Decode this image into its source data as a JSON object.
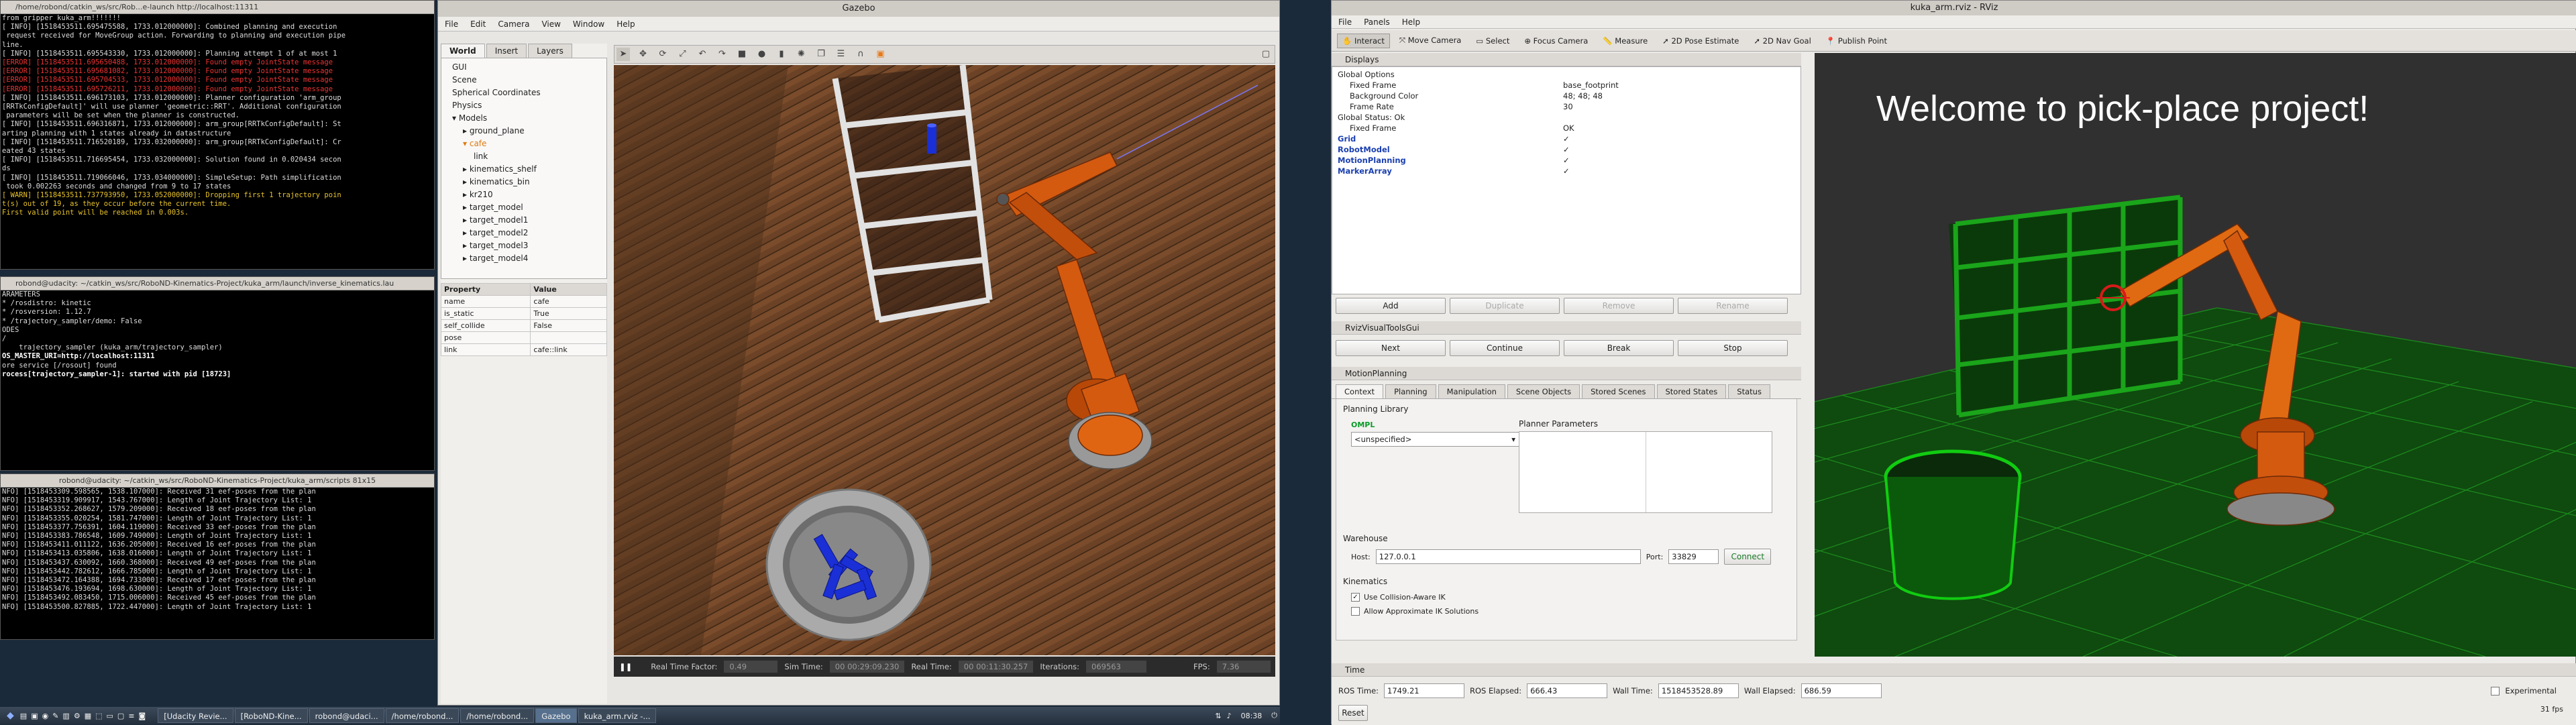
{
  "term1": {
    "title": "/home/robond/catkin_ws/src/Rob...e-launch http://localhost:11311",
    "lines": [
      {
        "t": "from gripper kuka_arm!!!!!!!",
        "c": "c-w"
      },
      {
        "t": "[ INFO] [1518453511.695475588, 1733.012000000]: Combined planning and execution",
        "c": "c-w"
      },
      {
        "t": " request received for MoveGroup action. Forwarding to planning and execution pipe",
        "c": "c-w"
      },
      {
        "t": "line.",
        "c": "c-w"
      },
      {
        "t": "[ INFO] [1518453511.695543330, 1733.012000000]: Planning attempt 1 of at most 1",
        "c": "c-w"
      },
      {
        "t": "[ERROR] [1518453511.695650488, 1733.012000000]: Found empty JointState message",
        "c": "c-r"
      },
      {
        "t": "[ERROR] [1518453511.695681082, 1733.012000000]: Found empty JointState message",
        "c": "c-r"
      },
      {
        "t": "[ERROR] [1518453511.695704533, 1733.012000000]: Found empty JointState message",
        "c": "c-r"
      },
      {
        "t": "[ERROR] [1518453511.695726211, 1733.012000000]: Found empty JointState message",
        "c": "c-r"
      },
      {
        "t": "[ INFO] [1518453511.696173103, 1733.012000000]: Planner configuration 'arm_group",
        "c": "c-w"
      },
      {
        "t": "[RRTkConfigDefault]' will use planner 'geometric::RRT'. Additional configuration",
        "c": "c-w"
      },
      {
        "t": " parameters will be set when the planner is constructed.",
        "c": "c-w"
      },
      {
        "t": "[ INFO] [1518453511.696316871, 1733.012000000]: arm_group[RRTkConfigDefault]: St",
        "c": "c-w"
      },
      {
        "t": "arting planning with 1 states already in datastructure",
        "c": "c-w"
      },
      {
        "t": "[ INFO] [1518453511.716520189, 1733.032000000]: arm_group[RRTkConfigDefault]: Cr",
        "c": "c-w"
      },
      {
        "t": "eated 43 states",
        "c": "c-w"
      },
      {
        "t": "[ INFO] [1518453511.716695454, 1733.032000000]: Solution found in 0.020434 secon",
        "c": "c-w"
      },
      {
        "t": "ds",
        "c": "c-w"
      },
      {
        "t": "[ INFO] [1518453511.719066046, 1733.034000000]: SimpleSetup: Path simplification",
        "c": "c-w"
      },
      {
        "t": " took 0.002263 seconds and changed from 9 to 17 states",
        "c": "c-w"
      },
      {
        "t": "[ WARN] [1518453511.737793950, 1733.052000000]: Dropping first 1 trajectory poin",
        "c": "c-y"
      },
      {
        "t": "t(s) out of 19, as they occur before the current time.",
        "c": "c-y"
      },
      {
        "t": "First valid point will be reached in 0.003s.",
        "c": "c-y"
      }
    ]
  },
  "term2": {
    "title": "robond@udacity: ~/catkin_ws/src/RoboND-Kinematics-Project/kuka_arm/launch/inverse_kinematics.lau",
    "lines": [
      {
        "t": "",
        "c": "c-w"
      },
      {
        "t": "",
        "c": "c-w"
      },
      {
        "t": "ARAMETERS",
        "c": "c-w"
      },
      {
        "t": "* /rosdistro: kinetic",
        "c": "c-w"
      },
      {
        "t": "* /rosversion: 1.12.7",
        "c": "c-w"
      },
      {
        "t": "* /trajectory_sampler/demo: False",
        "c": "c-w"
      },
      {
        "t": "",
        "c": "c-w"
      },
      {
        "t": "ODES",
        "c": "c-w"
      },
      {
        "t": "/",
        "c": "c-w"
      },
      {
        "t": "    trajectory_sampler (kuka_arm/trajectory_sampler)",
        "c": "c-w"
      },
      {
        "t": "",
        "c": "c-w"
      },
      {
        "t": "OS_MASTER_URI=http://localhost:11311",
        "c": "c-b"
      },
      {
        "t": "",
        "c": "c-w"
      },
      {
        "t": "ore service [/rosout] found",
        "c": "c-w"
      },
      {
        "t": "rocess[trajectory_sampler-1]: started with pid [18723]",
        "c": "c-b"
      }
    ]
  },
  "term3": {
    "title": "robond@udacity: ~/catkin_ws/src/RoboND-Kinematics-Project/kuka_arm/scripts 81x15",
    "lines": [
      {
        "t": "NFO] [1518453309.598565, 1538.107000]: Received 31 eef-poses from the plan",
        "c": "c-w"
      },
      {
        "t": "NFO] [1518453319.909917, 1543.767000]: Length of Joint Trajectory List: 1",
        "c": "c-w"
      },
      {
        "t": "NFO] [1518453352.268627, 1579.209000]: Received 18 eef-poses from the plan",
        "c": "c-w"
      },
      {
        "t": "NFO] [1518453355.020254, 1581.747000]: Length of Joint Trajectory List: 1",
        "c": "c-w"
      },
      {
        "t": "NFO] [1518453377.756391, 1604.119000]: Received 33 eef-poses from the plan",
        "c": "c-w"
      },
      {
        "t": "NFO] [1518453383.786548, 1609.749000]: Length of Joint Trajectory List: 1",
        "c": "c-w"
      },
      {
        "t": "NFO] [1518453411.011122, 1636.205000]: Received 16 eef-poses from the plan",
        "c": "c-w"
      },
      {
        "t": "NFO] [1518453413.035806, 1638.016000]: Length of Joint Trajectory List: 1",
        "c": "c-w"
      },
      {
        "t": "NFO] [1518453437.630092, 1660.368000]: Received 49 eef-poses from the plan",
        "c": "c-w"
      },
      {
        "t": "NFO] [1518453442.782612, 1666.785000]: Length of Joint Trajectory List: 1",
        "c": "c-w"
      },
      {
        "t": "NFO] [1518453472.164388, 1694.733000]: Received 17 eef-poses from the plan",
        "c": "c-w"
      },
      {
        "t": "NFO] [1518453476.193694, 1698.630000]: Length of Joint Trajectory List: 1",
        "c": "c-w"
      },
      {
        "t": "NFO] [1518453492.083450, 1715.006000]: Received 45 eef-poses from the plan",
        "c": "c-w"
      },
      {
        "t": "NFO] [1518453500.827885, 1722.447000]: Length of Joint Trajectory List: 1",
        "c": "c-w"
      }
    ]
  },
  "gazebo": {
    "title": "Gazebo",
    "menu": [
      "File",
      "Edit",
      "Camera",
      "View",
      "Window",
      "Help"
    ],
    "tabs": [
      "World",
      "Insert",
      "Layers"
    ],
    "tree": [
      "GUI",
      "Scene",
      "Spherical Coordinates",
      "Physics",
      "Models",
      "ground_plane",
      "cafe",
      "link",
      "kinematics_shelf",
      "kinematics_bin",
      "kr210",
      "target_model",
      "target_model1",
      "target_model2",
      "target_model3",
      "target_model4"
    ],
    "props_header": [
      "Property",
      "Value"
    ],
    "props": [
      {
        "k": "name",
        "v": "cafe"
      },
      {
        "k": "is_static",
        "v": "True"
      },
      {
        "k": "self_collide",
        "v": "False"
      },
      {
        "k": "pose",
        "v": ""
      },
      {
        "k": "link",
        "v": "cafe::link"
      }
    ],
    "status": {
      "rtf_label": "Real Time Factor:",
      "rtf": "0.49",
      "sim_label": "Sim Time:",
      "sim": "00 00:29:09.230",
      "real_label": "Real Time:",
      "real": "00 00:11:30.257",
      "iter_label": "Iterations:",
      "iter": "069563",
      "fps_label": "FPS:",
      "fps": "7.36"
    }
  },
  "rviz": {
    "title": "kuka_arm.rviz - RViz",
    "menu": [
      "File",
      "Panels",
      "Help"
    ],
    "tools": [
      "Interact",
      "Move Camera",
      "Select",
      "Focus Camera",
      "Measure",
      "2D Pose Estimate",
      "2D Nav Goal",
      "Publish Point"
    ],
    "displays_title": "Displays",
    "displays": [
      {
        "n": "Global Options",
        "v": "",
        "lvl": 0,
        "cls": ""
      },
      {
        "n": "Fixed Frame",
        "v": "base_footprint",
        "lvl": 1,
        "cls": ""
      },
      {
        "n": "Background Color",
        "v": "48; 48; 48",
        "lvl": 1,
        "cls": ""
      },
      {
        "n": "Frame Rate",
        "v": "30",
        "lvl": 1,
        "cls": ""
      },
      {
        "n": "Global Status: Ok",
        "v": "",
        "lvl": 0,
        "cls": ""
      },
      {
        "n": "Fixed Frame",
        "v": "OK",
        "lvl": 1,
        "cls": ""
      },
      {
        "n": "Grid",
        "v": "✓",
        "lvl": 0,
        "cls": "blue"
      },
      {
        "n": "RobotModel",
        "v": "✓",
        "lvl": 0,
        "cls": "blue"
      },
      {
        "n": "MotionPlanning",
        "v": "✓",
        "lvl": 0,
        "cls": "blue"
      },
      {
        "n": "MarkerArray",
        "v": "✓",
        "lvl": 0,
        "cls": "blue"
      }
    ],
    "display_buttons": [
      "Add",
      "Duplicate",
      "Remove",
      "Rename"
    ],
    "vtools_title": "RvizVisualToolsGui",
    "vtools_buttons": [
      "Next",
      "Continue",
      "Break",
      "Stop"
    ],
    "mp_title": "MotionPlanning",
    "mp_tabs": [
      "Context",
      "Planning",
      "Manipulation",
      "Scene Objects",
      "Stored Scenes",
      "Stored States",
      "Status"
    ],
    "planning_library": "Planning Library",
    "ompl": "OMPL",
    "planner_select": "<unspecified>",
    "planner_params": "Planner Parameters",
    "warehouse": "Warehouse",
    "host_label": "Host:",
    "host": "127.0.0.1",
    "port_label": "Port:",
    "port": "33829",
    "connect": "Connect",
    "kinematics": "Kinematics",
    "cb1": "Use Collision-Aware IK",
    "cb2": "Allow Approximate IK Solutions",
    "welcome": "Welcome  to  pick-place  project!",
    "time_title": "Time",
    "ros_time_label": "ROS Time:",
    "ros_time": "1749.21",
    "ros_elapsed_label": "ROS Elapsed:",
    "ros_elapsed": "666.43",
    "wall_time_label": "Wall Time:",
    "wall_time": "1518453528.89",
    "wall_elapsed_label": "Wall Elapsed:",
    "wall_elapsed": "686.59",
    "experimental": "Experimental",
    "reset": "Reset",
    "fps": "31 fps"
  },
  "taskbar": {
    "tasks": [
      "[Udacity Revie...",
      "[RoboND-Kine...",
      "robond@udaci...",
      "/home/robond...",
      "/home/robond...",
      "Gazebo",
      "kuka_arm.rviz -..."
    ],
    "clock": "08:38"
  }
}
